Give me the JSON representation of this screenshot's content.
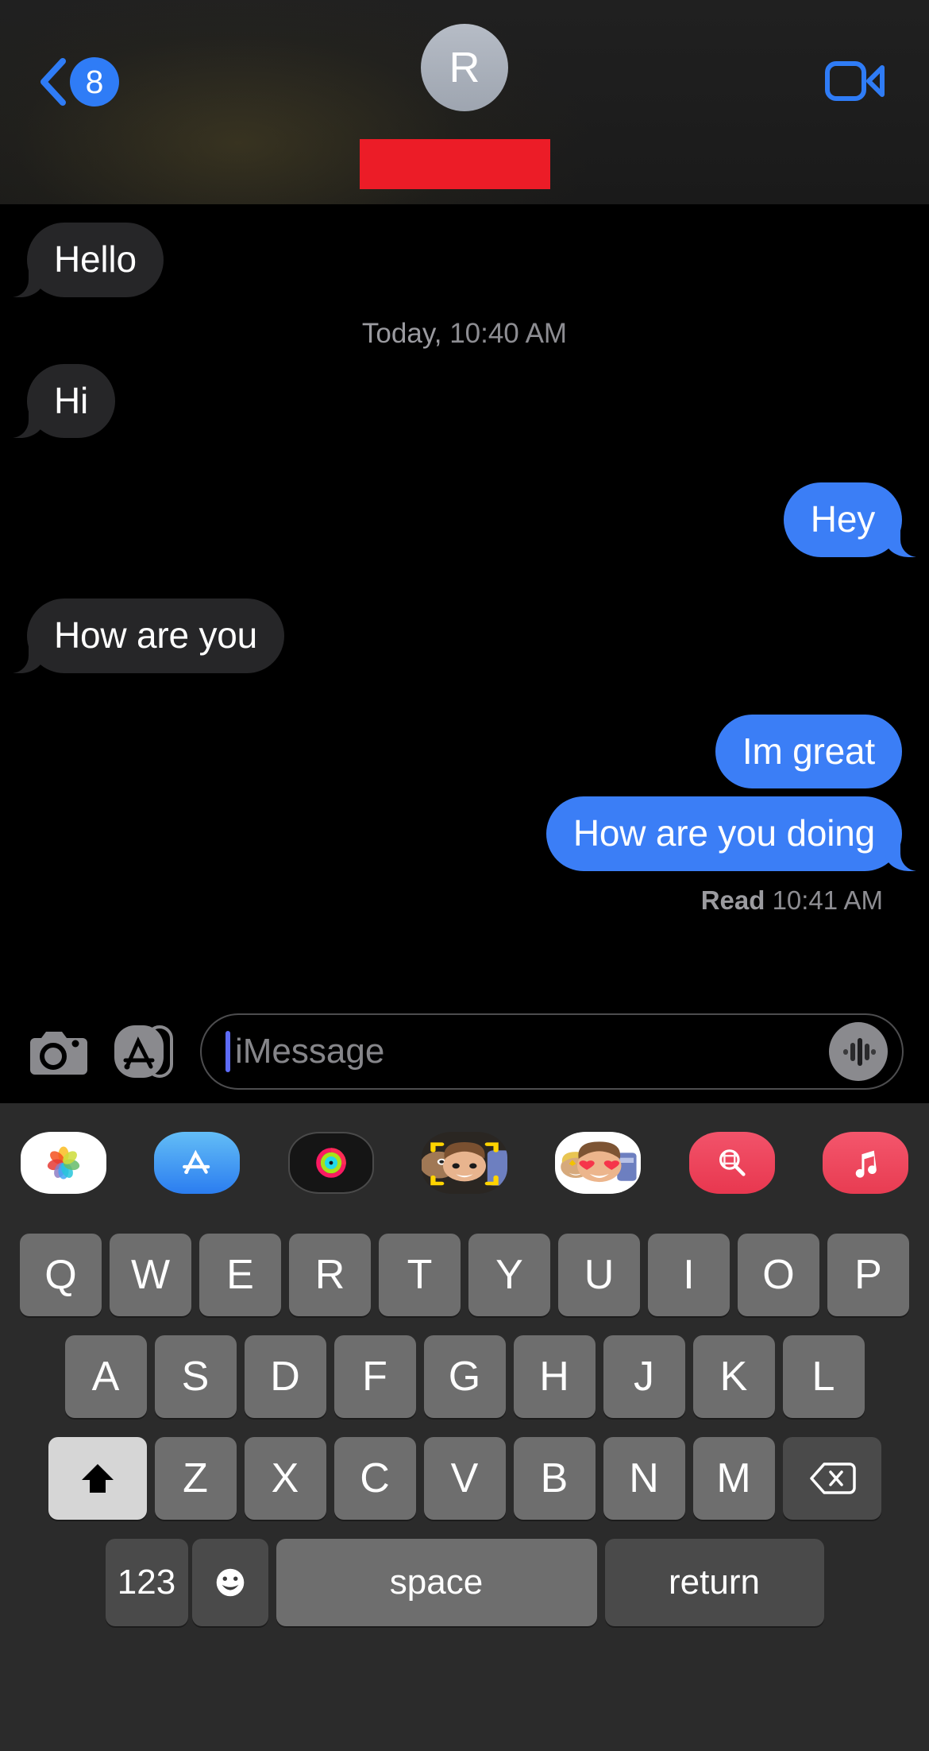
{
  "navbar": {
    "back_badge": "8",
    "back_icon": "chevron-left-icon",
    "avatar_initial": "R",
    "avatar_label": "contact-avatar",
    "name_redacted": true,
    "redaction_color": "#ec1c27",
    "facetime_icon": "video-camera-icon"
  },
  "thread": {
    "messages": [
      {
        "id": 0,
        "text": "Hello",
        "side": "in",
        "tail": true
      },
      {
        "id": 1,
        "kind": "daystamp",
        "day": "Today,",
        "time": "10:40 AM"
      },
      {
        "id": 2,
        "text": "Hi",
        "side": "in",
        "tail": true
      },
      {
        "id": 3,
        "text": "Hey",
        "side": "out",
        "tail": true
      },
      {
        "id": 4,
        "text": "How are you",
        "side": "in",
        "tail": true
      },
      {
        "id": 5,
        "text": "Im great",
        "side": "out",
        "tail": false
      },
      {
        "id": 6,
        "text": "How are you doing",
        "side": "out",
        "tail": true
      },
      {
        "id": 7,
        "kind": "readstamp",
        "status": "Read",
        "time": "10:41 AM"
      }
    ],
    "bubble_in_color": "#262628",
    "bubble_out_color": "#3b7ef6"
  },
  "inputbar": {
    "camera_icon": "camera-icon",
    "appstore_icon": "app-store-icon",
    "placeholder": "iMessage",
    "value": "",
    "audio_icon": "audio-waveform-icon"
  },
  "appdrawer": {
    "apps": [
      {
        "name": "photos-app-icon",
        "label": "Photos"
      },
      {
        "name": "app-store-app-icon",
        "label": "App Store"
      },
      {
        "name": "activity-rings-app-icon",
        "label": "Fitness"
      },
      {
        "name": "memoji-camera-app-icon",
        "label": "Memoji Camera"
      },
      {
        "name": "memoji-stickers-app-icon",
        "label": "Memoji Stickers"
      },
      {
        "name": "images-search-app-icon",
        "label": "#images"
      },
      {
        "name": "apple-music-app-icon",
        "label": "Music"
      }
    ]
  },
  "keyboard": {
    "row1": [
      "Q",
      "W",
      "E",
      "R",
      "T",
      "Y",
      "U",
      "I",
      "O",
      "P"
    ],
    "row2": [
      "A",
      "S",
      "D",
      "F",
      "G",
      "H",
      "J",
      "K",
      "L"
    ],
    "row3": [
      "Z",
      "X",
      "C",
      "V",
      "B",
      "N",
      "M"
    ],
    "shift_icon": "shift-arrow-icon",
    "shift_active": true,
    "backspace_icon": "backspace-delete-icon",
    "numbers_label": "123",
    "emoji_icon": "emoji-smiley-icon",
    "space_label": "space",
    "return_label": "return"
  }
}
